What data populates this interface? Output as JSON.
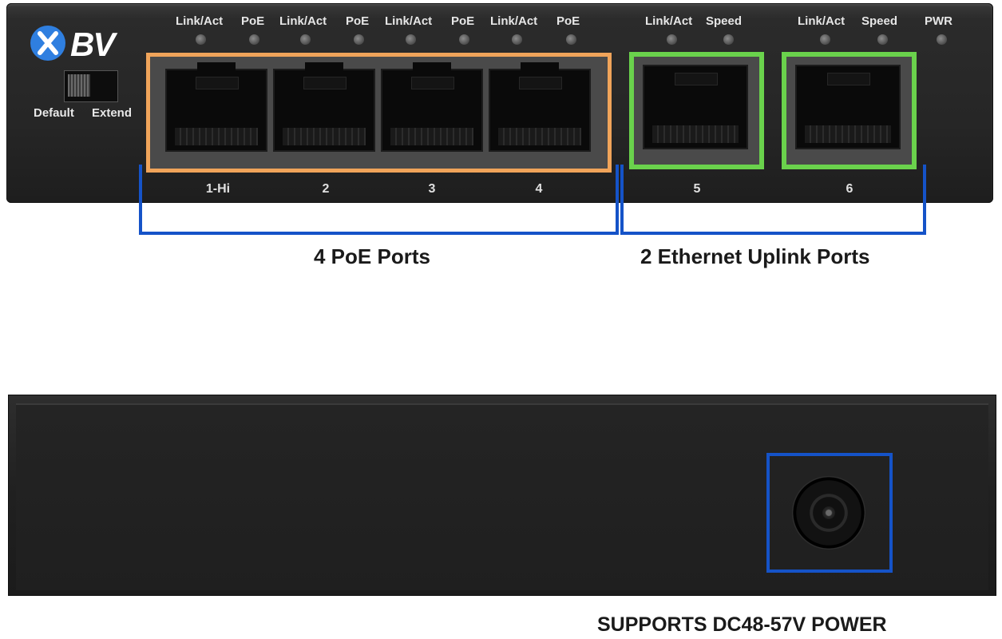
{
  "brand": {
    "logo_text": "BV"
  },
  "switch_labels": {
    "left": "Default",
    "right": "Extend"
  },
  "leds": [
    {
      "label": "Link/Act"
    },
    {
      "label": "PoE"
    },
    {
      "label": "Link/Act"
    },
    {
      "label": "PoE"
    },
    {
      "label": "Link/Act"
    },
    {
      "label": "PoE"
    },
    {
      "label": "Link/Act"
    },
    {
      "label": "PoE"
    },
    {
      "label": "Link/Act"
    },
    {
      "label": "Speed"
    },
    {
      "label": "Link/Act"
    },
    {
      "label": "Speed"
    },
    {
      "label": "PWR"
    }
  ],
  "ports": [
    {
      "label": "1-Hi"
    },
    {
      "label": "2"
    },
    {
      "label": "3"
    },
    {
      "label": "4"
    },
    {
      "label": "5"
    },
    {
      "label": "6"
    }
  ],
  "captions": {
    "poe": "4 PoE Ports",
    "uplink": "2 Ethernet Uplink Ports",
    "power": "SUPPORTS DC48-57V POWER"
  },
  "colors": {
    "poe_highlight": "#f0a45a",
    "uplink_highlight": "#6ad24c",
    "bracket": "#1553c8"
  }
}
